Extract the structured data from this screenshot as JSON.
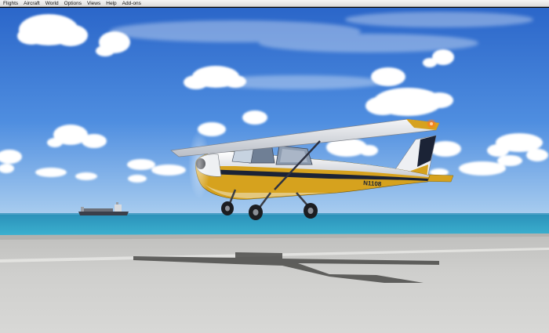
{
  "menu": {
    "items": [
      "Flights",
      "Aircraft",
      "World",
      "Options",
      "Views",
      "Help",
      "Add-ons"
    ]
  },
  "aircraft": {
    "registration": "N1108",
    "fuselage_color": "#d6a21e",
    "stripe_color": "#1b2336",
    "body_color": "#eef0f3",
    "beacon_color": "#ff7a1a"
  },
  "scene": {
    "sky_top": "#2f6fd0",
    "sky_horizon": "#a9cdef",
    "sea_color": "#2c9cc0",
    "runway_color": "#c9c9c7",
    "ship_color": "#3b3f4a"
  },
  "icons": {
    "aircraft": "cessna-airplane-icon",
    "ship": "cargo-ship-icon"
  }
}
